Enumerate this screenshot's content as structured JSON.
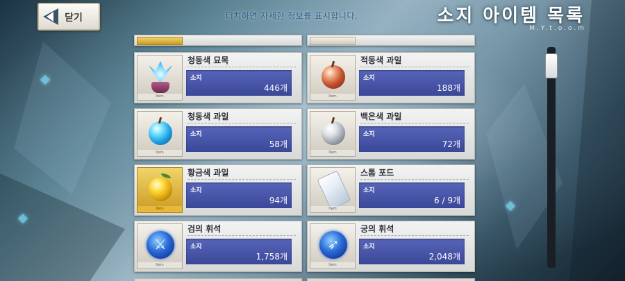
{
  "header": {
    "back_label": "닫기",
    "hint": "터치하면 자세한 정보를 표시합니다.",
    "title": "소지 아이템 목록",
    "watermark": "M.Y.t.o.o.m"
  },
  "labels": {
    "quantity": "소지",
    "thumb_footer": "Item"
  },
  "items": [
    {
      "name": "청동색 묘목",
      "quantity": "446개",
      "icon": "sapling-icon"
    },
    {
      "name": "적동색 과일",
      "quantity": "188개",
      "icon": "red-apple-icon"
    },
    {
      "name": "청동색 과일",
      "quantity": "58개",
      "icon": "blue-apple-icon"
    },
    {
      "name": "백은색 과일",
      "quantity": "72개",
      "icon": "silver-apple-icon"
    },
    {
      "name": "황금색 과일",
      "quantity": "94개",
      "icon": "golden-apple-icon"
    },
    {
      "name": "스톰 포드",
      "quantity": "6 / 9개",
      "icon": "storm-pod-icon"
    },
    {
      "name": "검의 휘석",
      "quantity": "1,758개",
      "icon": "saber-gem-icon"
    },
    {
      "name": "궁의 휘석",
      "quantity": "2,048개",
      "icon": "archer-gem-icon"
    }
  ],
  "scroll_position": 0.02,
  "colors": {
    "quantity_panel": "#4654a8",
    "gold_frame": "#e7b83a",
    "hint_text": "#2d5c8a"
  }
}
